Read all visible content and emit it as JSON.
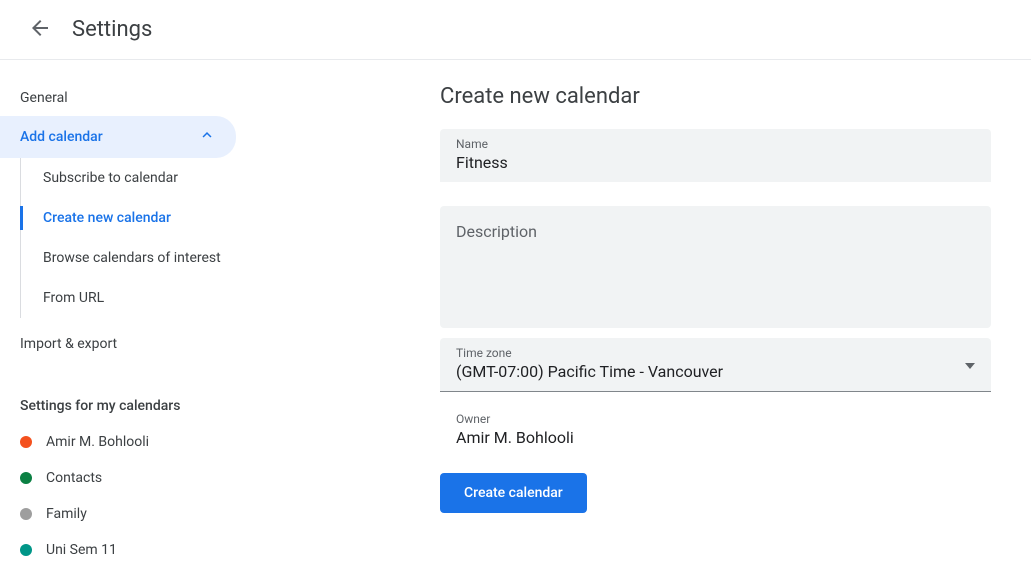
{
  "header": {
    "title": "Settings"
  },
  "sidebar": {
    "general": "General",
    "add_calendar": "Add calendar",
    "sub_items": [
      {
        "label": "Subscribe to calendar"
      },
      {
        "label": "Create new calendar"
      },
      {
        "label": "Browse calendars of interest"
      },
      {
        "label": "From URL"
      }
    ],
    "import_export": "Import & export",
    "my_calendars_title": "Settings for my calendars",
    "calendars": [
      {
        "label": "Amir M. Bohlooli",
        "color": "#f4511e"
      },
      {
        "label": "Contacts",
        "color": "#0b8043"
      },
      {
        "label": "Family",
        "color": "#9e9e9e"
      },
      {
        "label": "Uni Sem 11",
        "color": "#009688"
      }
    ]
  },
  "main": {
    "title": "Create new calendar",
    "name_label": "Name",
    "name_value": "Fitness",
    "description_label": "Description",
    "description_value": "",
    "timezone_label": "Time zone",
    "timezone_value": "(GMT-07:00) Pacific Time - Vancouver",
    "owner_label": "Owner",
    "owner_value": "Amir M. Bohlooli",
    "create_button": "Create calendar"
  }
}
